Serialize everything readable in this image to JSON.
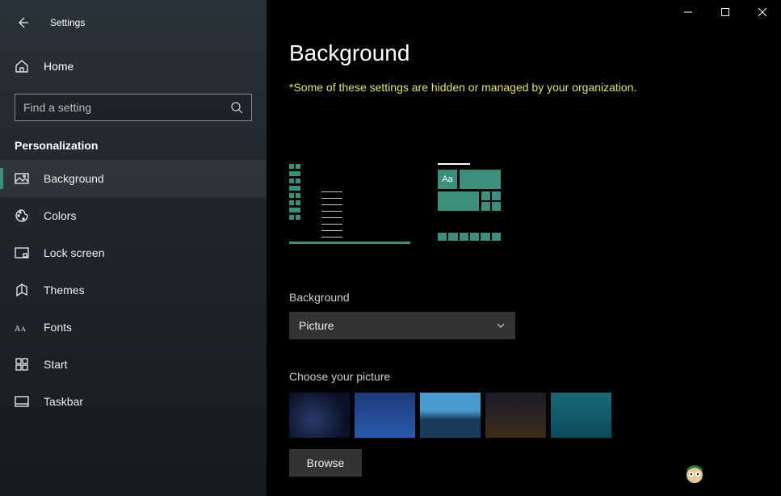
{
  "app_title": "Settings",
  "home_label": "Home",
  "search_placeholder": "Find a setting",
  "section_title": "Personalization",
  "sidebar_items": [
    {
      "label": "Background",
      "icon": "picture-icon",
      "selected": true
    },
    {
      "label": "Colors",
      "icon": "palette-icon",
      "selected": false
    },
    {
      "label": "Lock screen",
      "icon": "lock-screen-icon",
      "selected": false
    },
    {
      "label": "Themes",
      "icon": "themes-icon",
      "selected": false
    },
    {
      "label": "Fonts",
      "icon": "fonts-icon",
      "selected": false
    },
    {
      "label": "Start",
      "icon": "start-icon",
      "selected": false
    },
    {
      "label": "Taskbar",
      "icon": "taskbar-icon",
      "selected": false
    }
  ],
  "page_title": "Background",
  "org_notice": "*Some of these settings are hidden or managed by your organization.",
  "preview_sample_text": "Aa",
  "background_dropdown": {
    "label": "Background",
    "value": "Picture"
  },
  "choose_picture_label": "Choose your picture",
  "browse_label": "Browse",
  "picture_thumbnails": [
    {
      "name": "night-cabin"
    },
    {
      "name": "windows-blue"
    },
    {
      "name": "beach-reflection"
    },
    {
      "name": "starry-horizon"
    },
    {
      "name": "underwater"
    }
  ],
  "colors": {
    "accent": "#3c8f7c",
    "notice": "#e2e26a"
  }
}
